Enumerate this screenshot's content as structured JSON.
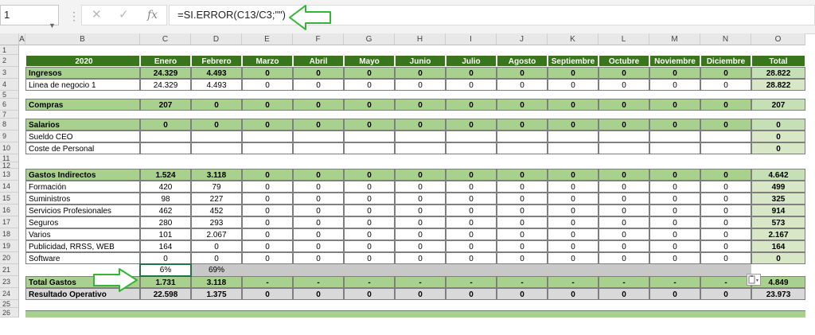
{
  "formula_bar": {
    "name_box": "1",
    "cancel_icon": "✕",
    "enter_icon": "✓",
    "fx_label": "fx",
    "formula": "=SI.ERROR(C13/C3;\"\")"
  },
  "colors": {
    "header_dark": "#38761d",
    "section_green": "#a9d18e",
    "light_green": "#d8e8c6",
    "total_col": "#c5e0b4",
    "selection": "#217346",
    "range_gray": "#c8c8c8",
    "annotation_arrow": "#35b535"
  },
  "columns": [
    "A",
    "B",
    "C",
    "D",
    "E",
    "F",
    "G",
    "H",
    "I",
    "J",
    "K",
    "L",
    "M",
    "N",
    "O"
  ],
  "rows": [
    "1",
    "2",
    "3",
    "4",
    "5",
    "6",
    "7",
    "8",
    "9",
    "10",
    "11",
    "12",
    "13",
    "14",
    "15",
    "16",
    "17",
    "18",
    "19",
    "20",
    "21",
    "23",
    "24",
    "25",
    "26"
  ],
  "sheet": {
    "header": [
      "2020",
      "Enero",
      "Febrero",
      "Marzo",
      "Abril",
      "Mayo",
      "Junio",
      "Julio",
      "Agosto",
      "Septiembre",
      "Octubre",
      "Noviembre",
      "Diciembre",
      "Total"
    ],
    "ingresos": [
      "Ingresos",
      "24.329",
      "4.493",
      "0",
      "0",
      "0",
      "0",
      "0",
      "0",
      "0",
      "0",
      "0",
      "0",
      "28.822"
    ],
    "linea": [
      "Linea de negocio 1",
      "24.329",
      "4.493",
      "0",
      "0",
      "0",
      "0",
      "0",
      "0",
      "0",
      "0",
      "0",
      "0",
      "28.822"
    ],
    "compras": [
      "Compras",
      "207",
      "0",
      "0",
      "0",
      "0",
      "0",
      "0",
      "0",
      "0",
      "0",
      "0",
      "0",
      "207"
    ],
    "salarios": [
      "Salarios",
      "0",
      "0",
      "0",
      "0",
      "0",
      "0",
      "0",
      "0",
      "0",
      "0",
      "0",
      "0",
      "0"
    ],
    "sueldo": [
      "Sueldo CEO",
      "",
      "",
      "",
      "",
      "",
      "",
      "",
      "",
      "",
      "",
      "",
      "",
      "0"
    ],
    "coste": [
      "Coste de Personal",
      "",
      "",
      "",
      "",
      "",
      "",
      "",
      "",
      "",
      "",
      "",
      "",
      "0"
    ],
    "gastos": [
      "Gastos Indirectos",
      "1.524",
      "3.118",
      "0",
      "0",
      "0",
      "0",
      "0",
      "0",
      "0",
      "0",
      "0",
      "0",
      "4.642"
    ],
    "formacion": [
      "Formación",
      "420",
      "79",
      "0",
      "0",
      "0",
      "0",
      "0",
      "0",
      "0",
      "0",
      "0",
      "0",
      "499"
    ],
    "suministros": [
      "Suministros",
      "98",
      "227",
      "0",
      "0",
      "0",
      "0",
      "0",
      "0",
      "0",
      "0",
      "0",
      "0",
      "325"
    ],
    "servicios": [
      "Servicios Profesionales",
      "462",
      "452",
      "0",
      "0",
      "0",
      "0",
      "0",
      "0",
      "0",
      "0",
      "0",
      "0",
      "914"
    ],
    "seguros": [
      "Seguros",
      "280",
      "293",
      "0",
      "0",
      "0",
      "0",
      "0",
      "0",
      "0",
      "0",
      "0",
      "0",
      "573"
    ],
    "varios": [
      "Varios",
      "101",
      "2.067",
      "0",
      "0",
      "0",
      "0",
      "0",
      "0",
      "0",
      "0",
      "0",
      "0",
      "2.167"
    ],
    "publicidad": [
      "Publicidad, RRSS, WEB",
      "164",
      "0",
      "0",
      "0",
      "0",
      "0",
      "0",
      "0",
      "0",
      "0",
      "0",
      "0",
      "164"
    ],
    "software": [
      "Software",
      "0",
      "0",
      "0",
      "0",
      "0",
      "0",
      "0",
      "0",
      "0",
      "0",
      "0",
      "0",
      "0"
    ],
    "ratio": [
      "",
      "6%",
      "69%",
      "",
      "",
      "",
      "",
      "",
      "",
      "",
      "",
      "",
      "",
      ""
    ],
    "total_gastos": [
      "Total Gastos",
      "1.731",
      "3.118",
      "-",
      "-",
      "-",
      "-",
      "-",
      "-",
      "-",
      "-",
      "-",
      "-",
      "4.849"
    ],
    "resultado": [
      "Resultado Operativo",
      "22.598",
      "1.375",
      "0",
      "0",
      "0",
      "0",
      "0",
      "0",
      "0",
      "0",
      "0",
      "0",
      "23.973"
    ]
  }
}
